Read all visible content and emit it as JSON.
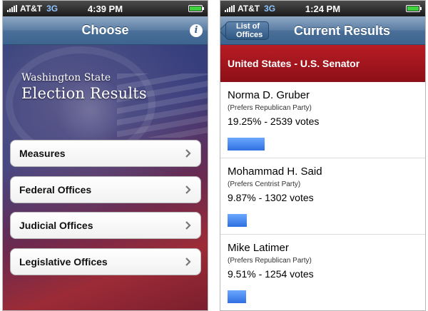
{
  "left_screen": {
    "status": {
      "carrier": "AT&T",
      "network": "3G",
      "time": "4:39 PM"
    },
    "nav": {
      "title": "Choose",
      "info_icon": "info-icon"
    },
    "brand": {
      "line1": "Washington State",
      "line2": "Election Results"
    },
    "menu": [
      {
        "label": "Measures"
      },
      {
        "label": "Federal Offices"
      },
      {
        "label": "Judicial Offices"
      },
      {
        "label": "Legislative Offices"
      }
    ]
  },
  "right_screen": {
    "status": {
      "carrier": "AT&T",
      "network": "3G",
      "time": "1:24 PM"
    },
    "nav": {
      "back_label": "List of Offices",
      "title": "Current Results"
    },
    "race_title": "United States - U.S. Senator",
    "candidates": [
      {
        "name": "Norma D. Gruber",
        "party": "(Prefers Republican Party)",
        "result": "19.25% - 2539 votes",
        "percent": 19.25
      },
      {
        "name": "Mohammad H. Said",
        "party": "(Prefers Centrist Party)",
        "result": "9.87% - 1302 votes",
        "percent": 9.87
      },
      {
        "name": "Mike Latimer",
        "party": "(Prefers Republican Party)",
        "result": "9.51% - 1254 votes",
        "percent": 9.51
      }
    ]
  },
  "colors": {
    "nav_blue": "#4a6f98",
    "race_header_red": "#b81c24",
    "bar_blue": "#2f6fe0",
    "network_label": "#8fc4ff"
  }
}
